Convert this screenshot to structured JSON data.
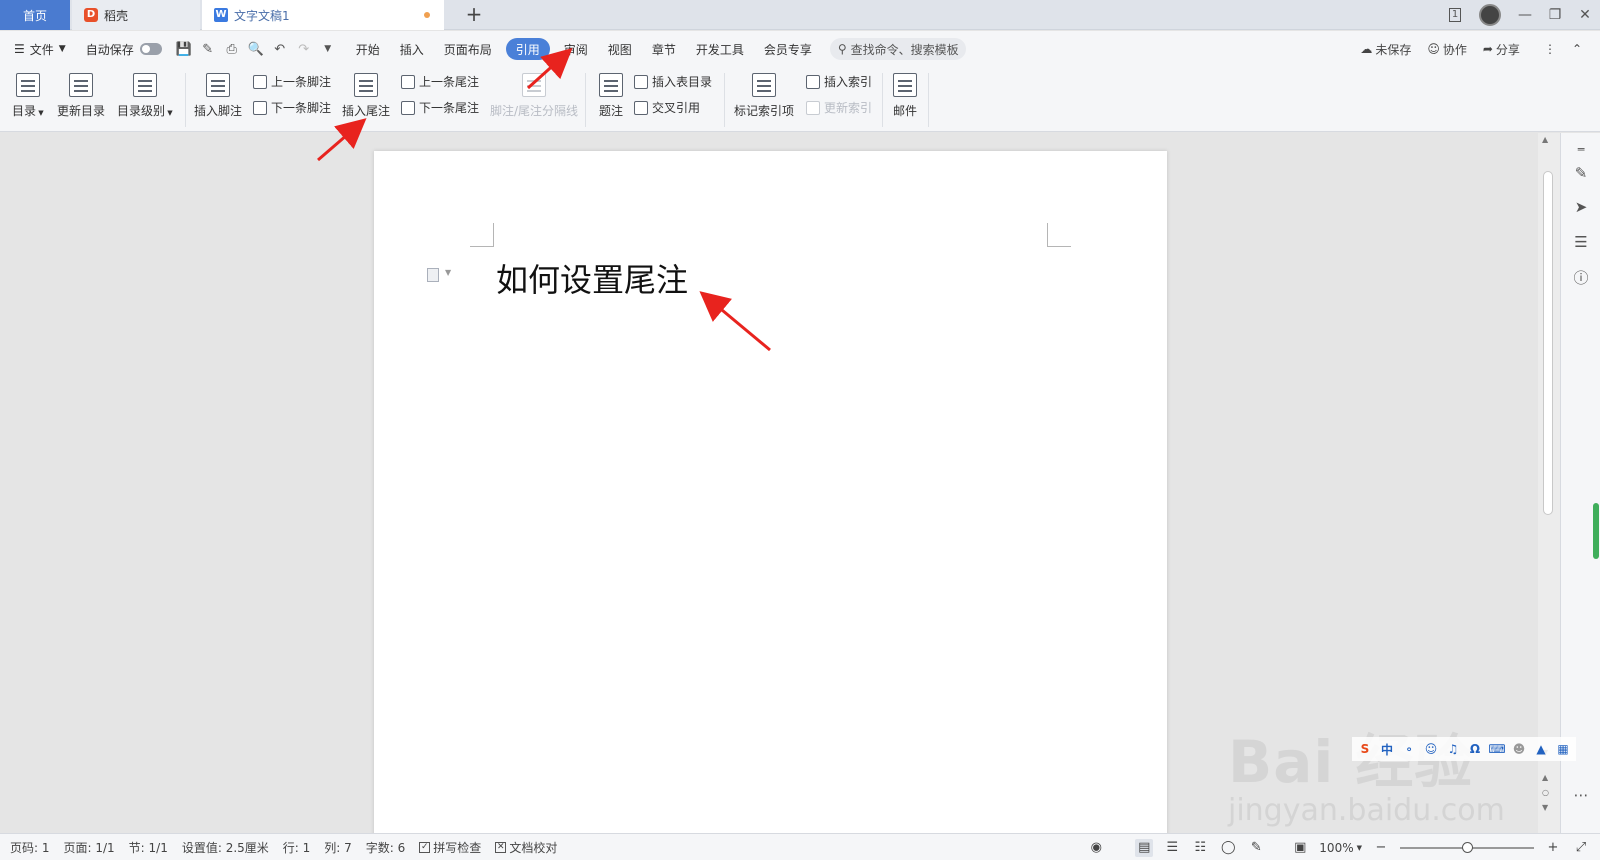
{
  "tabs": {
    "home": "首页",
    "daoke": "稻壳",
    "doc": "文字文稿1",
    "add": "+"
  },
  "window": {
    "badge": "1"
  },
  "menubar": {
    "file": "文件",
    "autosave": "自动保存",
    "items": [
      "开始",
      "插入",
      "页面布局",
      "引用",
      "审阅",
      "视图",
      "章节",
      "开发工具",
      "会员专享"
    ],
    "active_index": 3,
    "search": "查找命令、搜索模板",
    "unsaved": "未保存",
    "collab": "协作",
    "share": "分享"
  },
  "ribbon": {
    "toc": "目录",
    "update_toc": "更新目录",
    "toc_level": "目录级别",
    "insert_footnote": "插入脚注",
    "prev_footnote": "上一条脚注",
    "next_footnote": "下一条脚注",
    "insert_endnote": "插入尾注",
    "prev_endnote": "上一条尾注",
    "next_endnote": "下一条尾注",
    "separator": "脚注/尾注分隔线",
    "caption": "题注",
    "insert_table_of_figures": "插入表目录",
    "cross_reference": "交叉引用",
    "mark_index": "标记索引项",
    "insert_index": "插入索引",
    "update_index": "更新索引",
    "mail": "邮件"
  },
  "document": {
    "text": "如何设置尾注"
  },
  "ime": {
    "lang": "中"
  },
  "watermark": {
    "logo": "Bai 经验",
    "url": "jingyan.baidu.com"
  },
  "statusbar": {
    "page_num": "页码: 1",
    "pages": "页面: 1/1",
    "section": "节: 1/1",
    "position": "设置值: 2.5厘米",
    "row": "行: 1",
    "col": "列: 7",
    "words": "字数: 6",
    "spellcheck": "拼写检查",
    "proofread": "文档校对",
    "zoom": "100%",
    "zoom_fraction": 0.5
  },
  "colors": {
    "accent": "#4a80d8",
    "home_tab": "#4a7bd0",
    "annotation": "#e8231e"
  }
}
